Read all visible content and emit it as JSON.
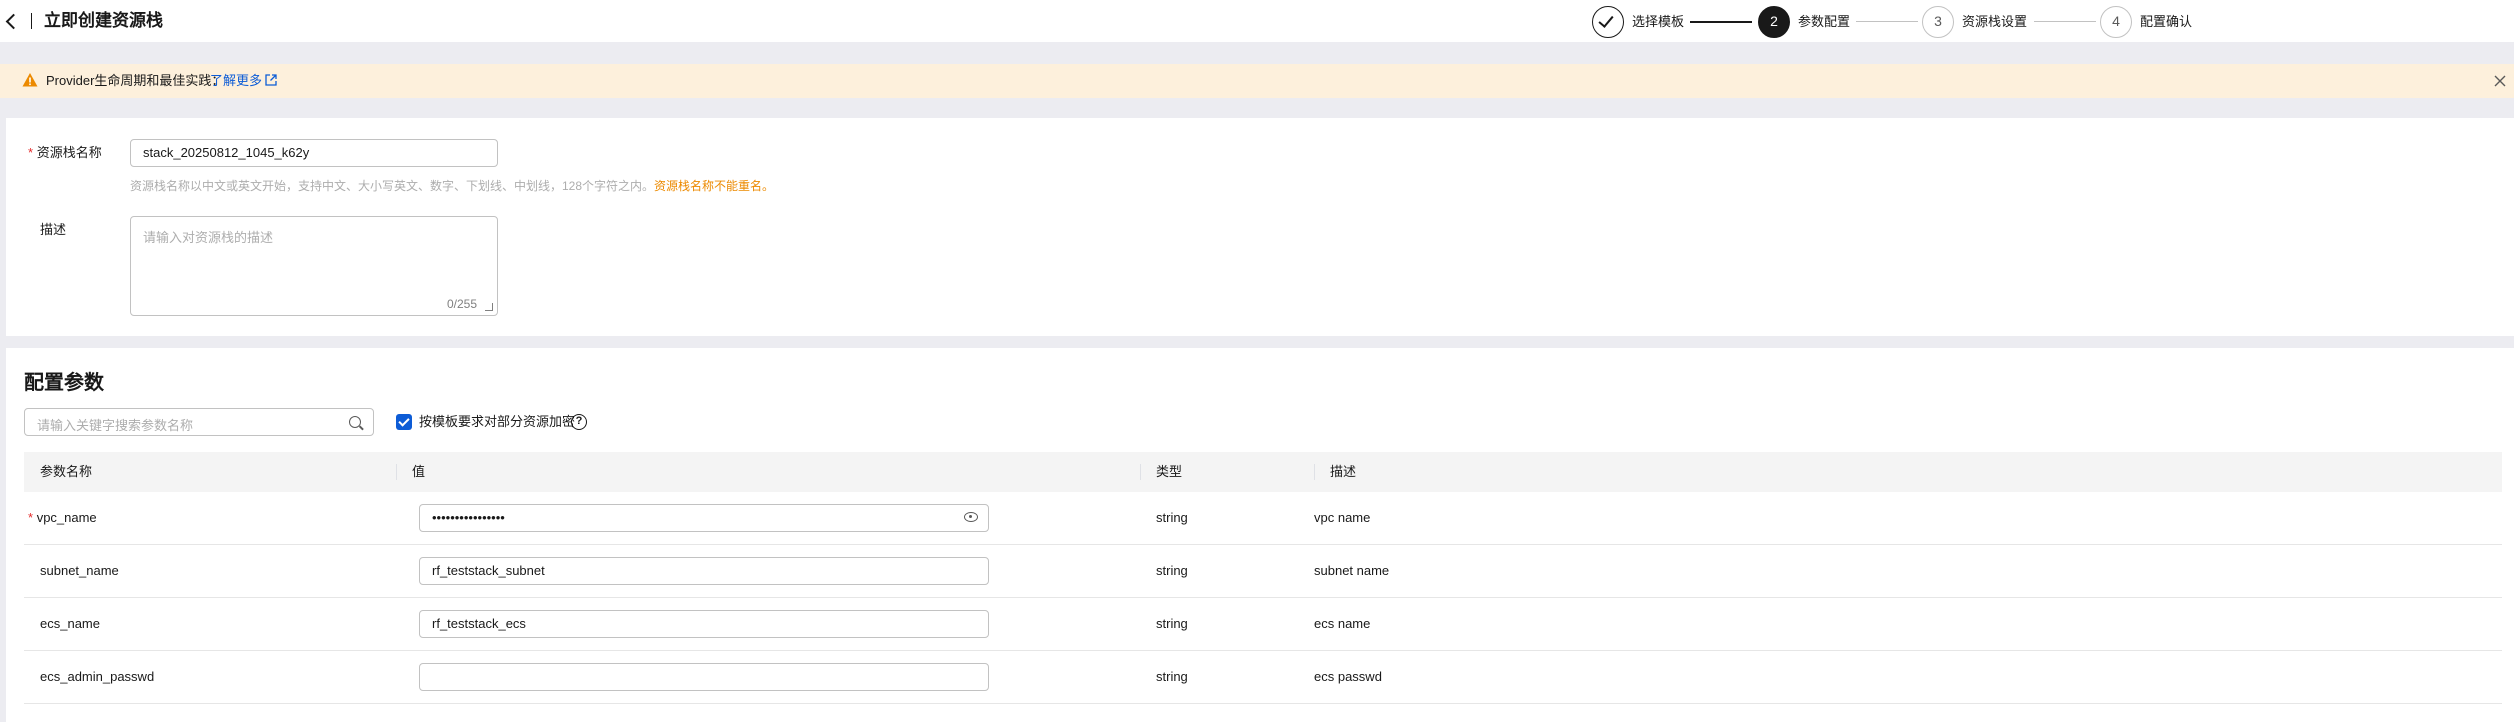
{
  "header": {
    "title": "立即创建资源栈"
  },
  "steps": [
    {
      "num": "",
      "label": "选择模板",
      "state": "done"
    },
    {
      "num": "2",
      "label": "参数配置",
      "state": "active"
    },
    {
      "num": "3",
      "label": "资源栈设置",
      "state": "todo"
    },
    {
      "num": "4",
      "label": "配置确认",
      "state": "todo"
    }
  ],
  "alert": {
    "text": "Provider生命周期和最佳实践：",
    "link": "了解更多"
  },
  "form": {
    "name_label": "资源栈名称",
    "name_value": "stack_20250812_1045_k62y",
    "name_hint": "资源栈名称以中文或英文开始，支持中文、大小写英文、数字、下划线、中划线，128个字符之内。",
    "name_hint_warn": "资源栈名称不能重名。",
    "desc_label": "描述",
    "desc_placeholder": "请输入对资源栈的描述",
    "desc_count": "0/255"
  },
  "params": {
    "title": "配置参数",
    "search_placeholder": "请输入关键字搜索参数名称",
    "encrypt_label": "按模板要求对部分资源加密",
    "columns": [
      "参数名称",
      "值",
      "类型",
      "描述"
    ],
    "rows": [
      {
        "name": "vpc_name",
        "required": true,
        "value": "••••••••••••••••",
        "masked": true,
        "type": "string",
        "desc": "vpc name"
      },
      {
        "name": "subnet_name",
        "required": false,
        "value": "rf_teststack_subnet",
        "masked": false,
        "type": "string",
        "desc": "subnet name"
      },
      {
        "name": "ecs_name",
        "required": false,
        "value": "rf_teststack_ecs",
        "masked": false,
        "type": "string",
        "desc": "ecs name"
      },
      {
        "name": "ecs_admin_passwd",
        "required": false,
        "value": "",
        "masked": false,
        "type": "string",
        "desc": "ecs passwd"
      }
    ]
  },
  "colors": {
    "accent": "#0d5cd6",
    "warning": "#ec8a00",
    "alert_bg": "#fdf0dc",
    "required": "#e52b2b"
  }
}
